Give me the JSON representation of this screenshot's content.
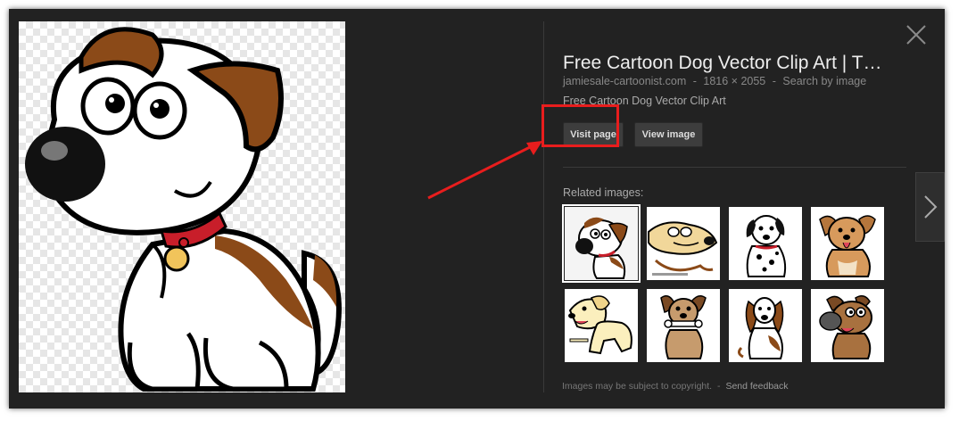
{
  "viewer": {
    "title": "Free Cartoon Dog Vector Clip Art | T…",
    "source_domain": "jamiesale-cartoonist.com",
    "separator": "-",
    "dimensions": "1816 × 2055",
    "search_by_image": "Search by image",
    "description": "Free Cartoon Dog Vector Clip Art",
    "visit_page_label": "Visit page",
    "view_image_label": "View image",
    "related_label": "Related images:",
    "footer_text": "Images may be subject to copyright.",
    "footer_separator": "-",
    "send_feedback": "Send feedback"
  },
  "icons": {
    "close": "close-icon",
    "next": "chevron-right-icon"
  },
  "colors": {
    "background": "#222222",
    "highlight": "#e81d1d",
    "title": "#eeeeee"
  }
}
